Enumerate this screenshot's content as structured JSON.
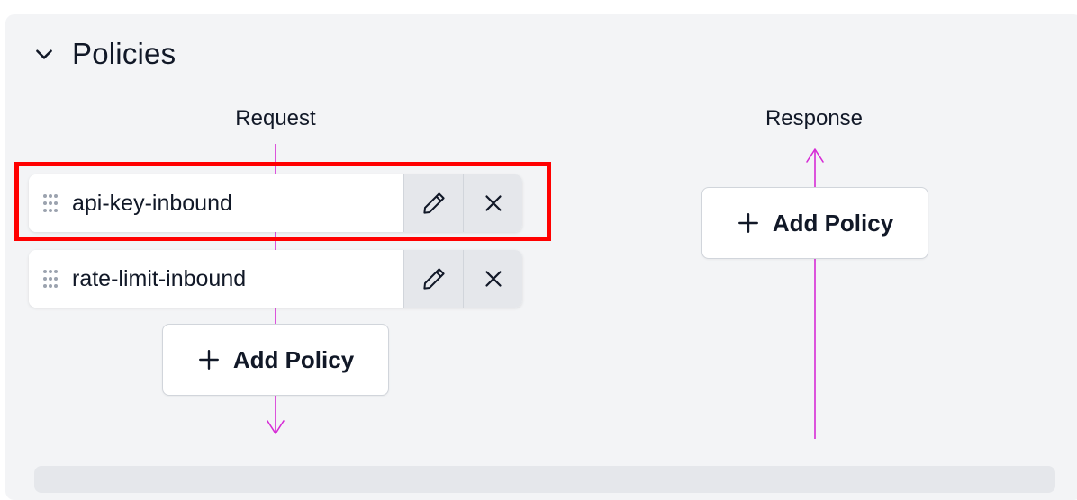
{
  "section": {
    "title": "Policies",
    "chevron_icon": "chevron-down-icon"
  },
  "request": {
    "label": "Request",
    "policies": [
      {
        "name": "api-key-inbound",
        "highlighted": true
      },
      {
        "name": "rate-limit-inbound",
        "highlighted": false
      }
    ],
    "add_label": "Add Policy"
  },
  "response": {
    "label": "Response",
    "add_label": "Add Policy"
  },
  "colors": {
    "flow_line": "#d62bd6",
    "highlight": "#ff0000",
    "panel_bg": "#f3f4f6"
  },
  "icons": {
    "drag": "drag-handle-icon",
    "edit": "pencil-icon",
    "remove": "close-icon",
    "add": "plus-icon"
  }
}
